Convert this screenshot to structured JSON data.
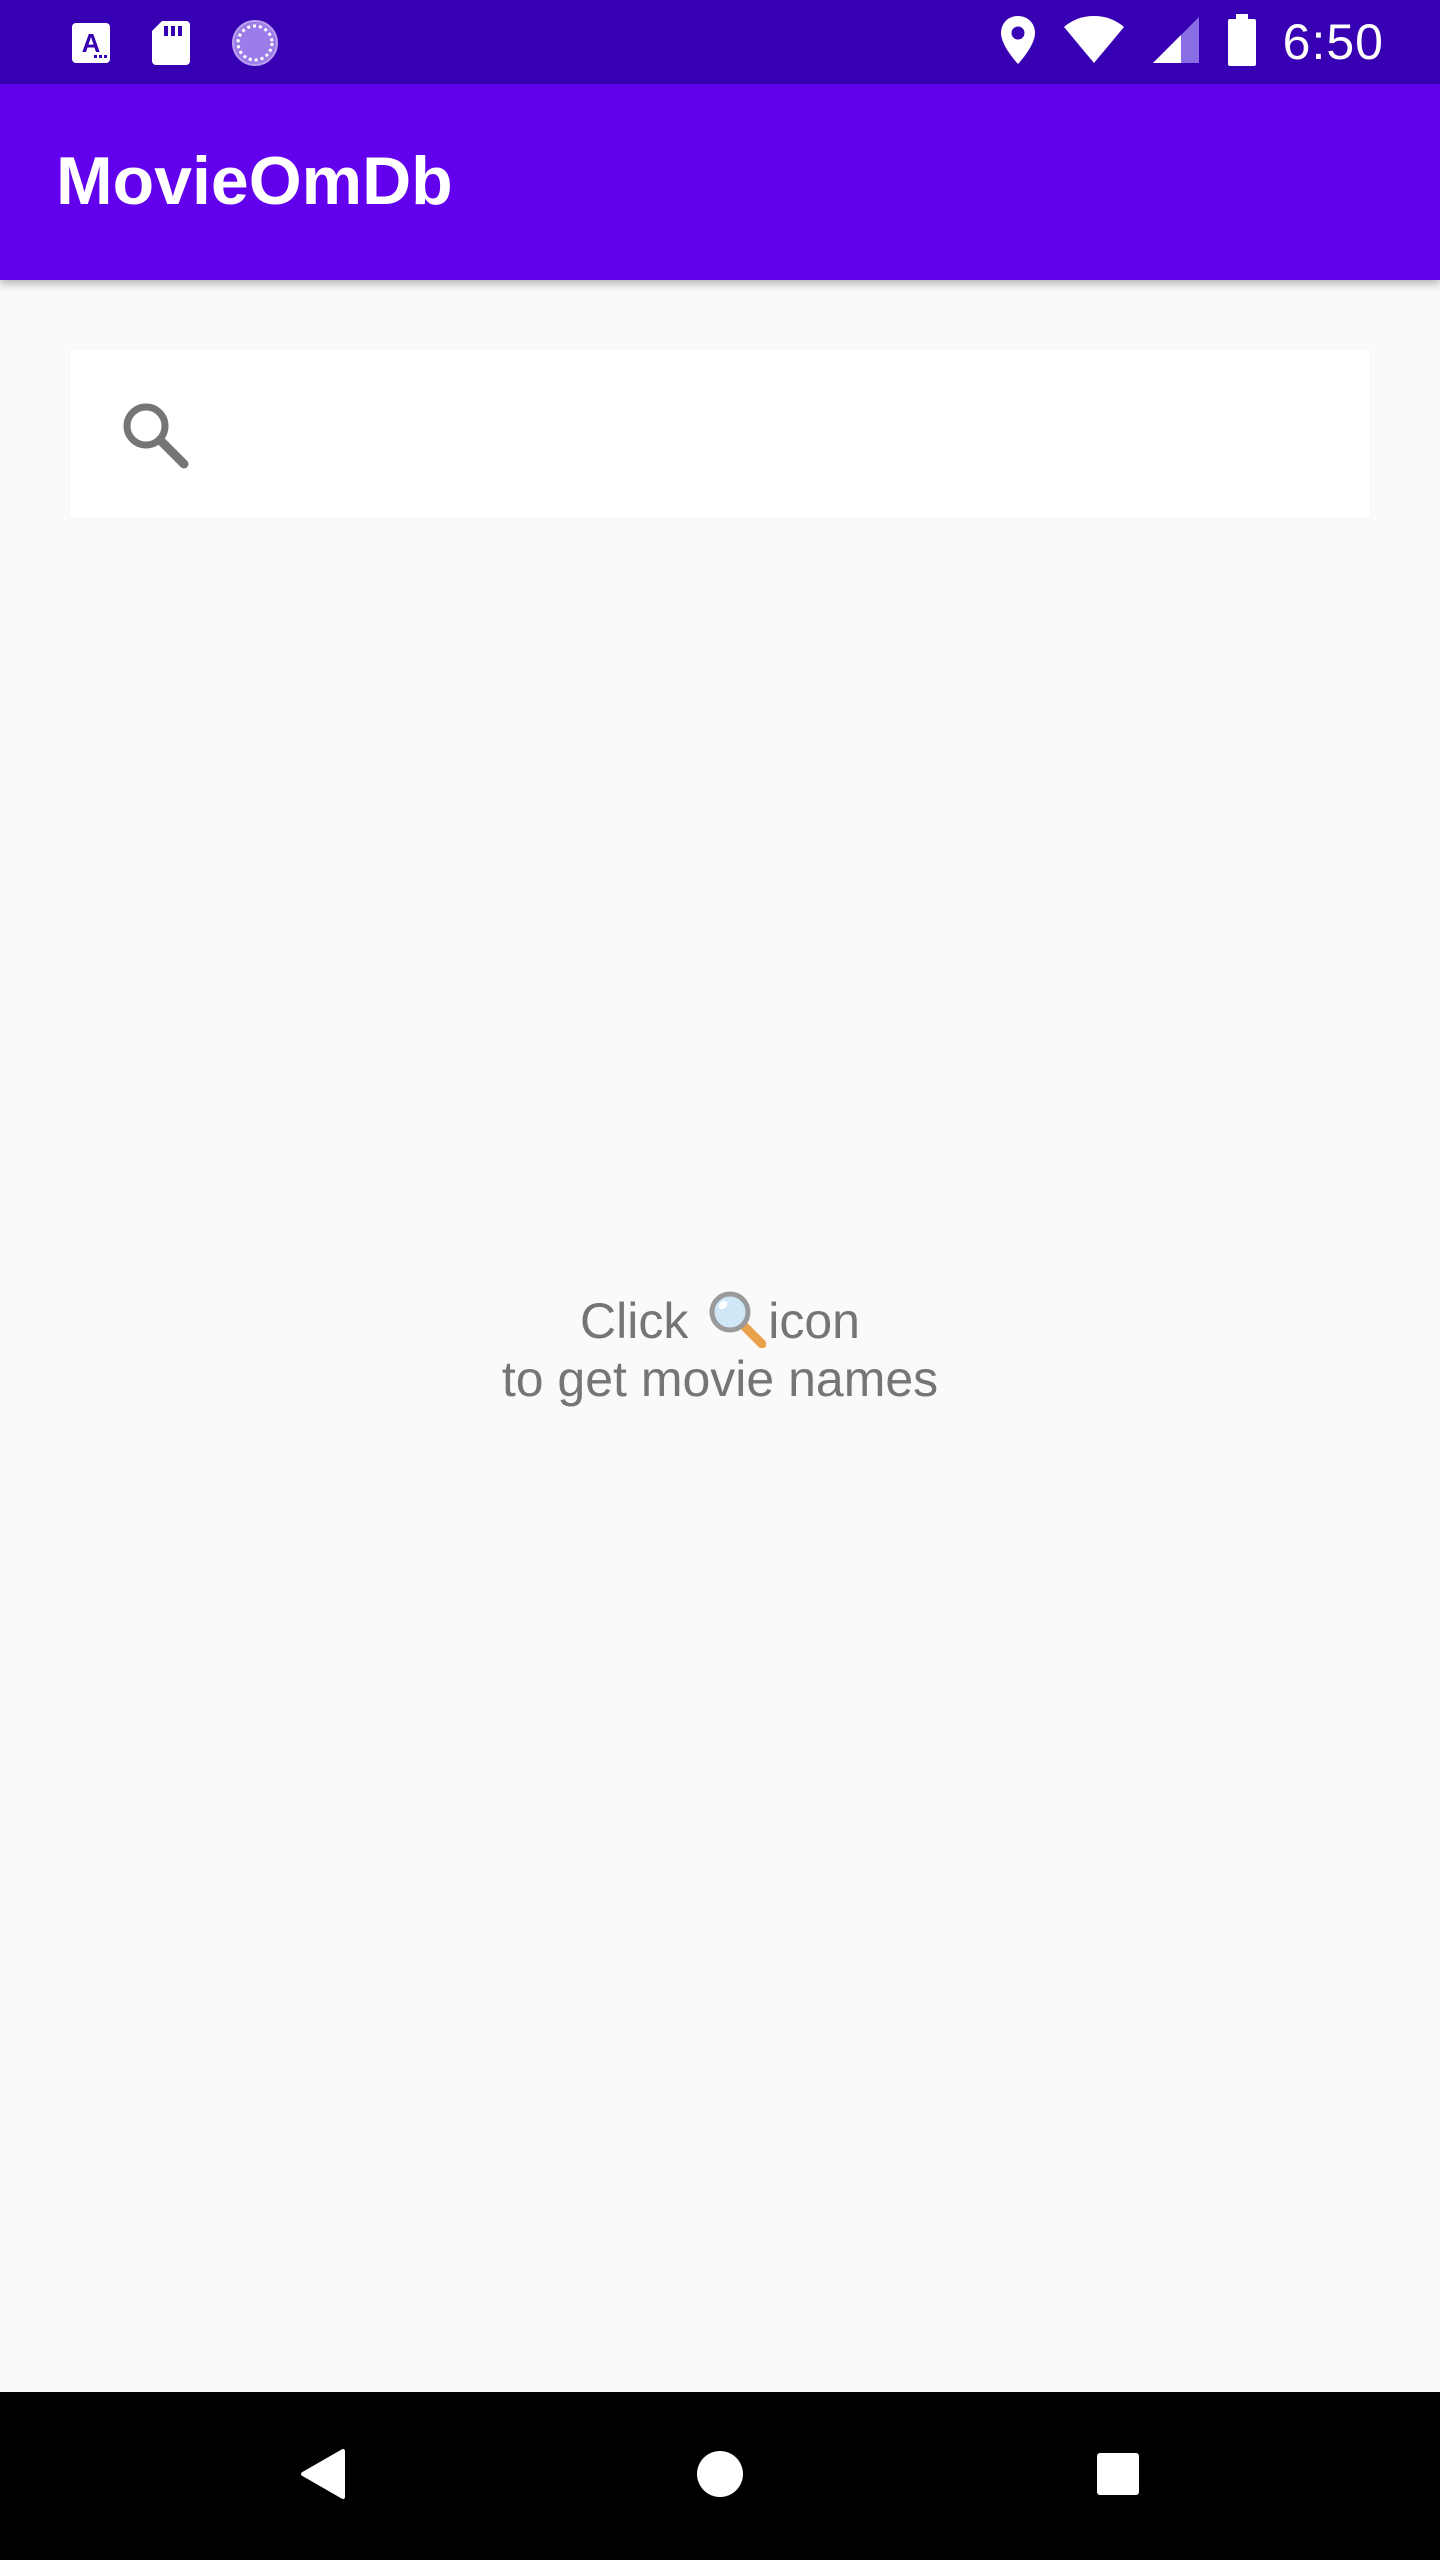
{
  "status_bar": {
    "time": "6:50",
    "left_icons": [
      "font-a-icon",
      "sd-card-icon",
      "sync-circle-icon"
    ],
    "right_icons": [
      "location-pin-icon",
      "wifi-icon",
      "cell-signal-icon",
      "battery-icon"
    ]
  },
  "app_bar": {
    "title": "MovieOmDb",
    "color": "#6200ee"
  },
  "search": {
    "icon": "search-icon",
    "value": "",
    "placeholder": ""
  },
  "empty_state": {
    "line1_prefix": "Click ",
    "line1_icon": "magnifying-glass-emoji-icon",
    "line1_suffix": "icon",
    "line2": "to get movie names"
  },
  "nav_bar": {
    "buttons": [
      "back-icon",
      "home-icon",
      "recents-icon"
    ]
  },
  "colors": {
    "status_bar": "#3700b3",
    "app_bar": "#6200ee",
    "background": "#fafafa",
    "text_secondary": "#757575"
  }
}
